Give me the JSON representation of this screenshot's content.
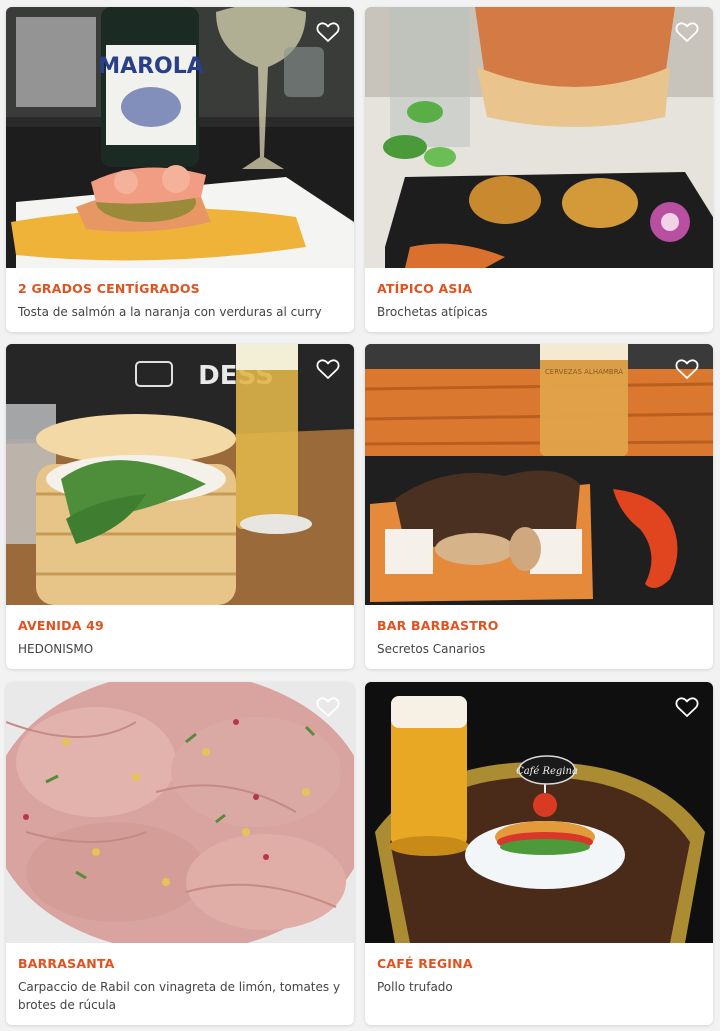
{
  "accent_color": "#e0521f",
  "icons": {
    "favorite": "heart-outline-icon"
  },
  "cards": [
    {
      "title": "2 GRADOS CENTÍGRADOS",
      "description": "Tosta de salmón a la naranja con verduras al curry",
      "bottle_label": "MAROLA"
    },
    {
      "title": "ATÍPICO ASIA",
      "description": "Brochetas atípicas"
    },
    {
      "title": "AVENIDA 49",
      "description": "HEDONISMO",
      "wall_text": "DESS"
    },
    {
      "title": "BAR BARBASTRO",
      "description": "Secretos Canarios",
      "glass_text": "CERVEZAS ALHAMBRA"
    },
    {
      "title": "BARRASANTA",
      "description": "Carpaccio de Rabil con vinagreta de limón, tomates y brotes de rúcula"
    },
    {
      "title": "CAFÉ REGINA",
      "description": "Pollo trufado",
      "sign_text": "Café Regina"
    }
  ]
}
